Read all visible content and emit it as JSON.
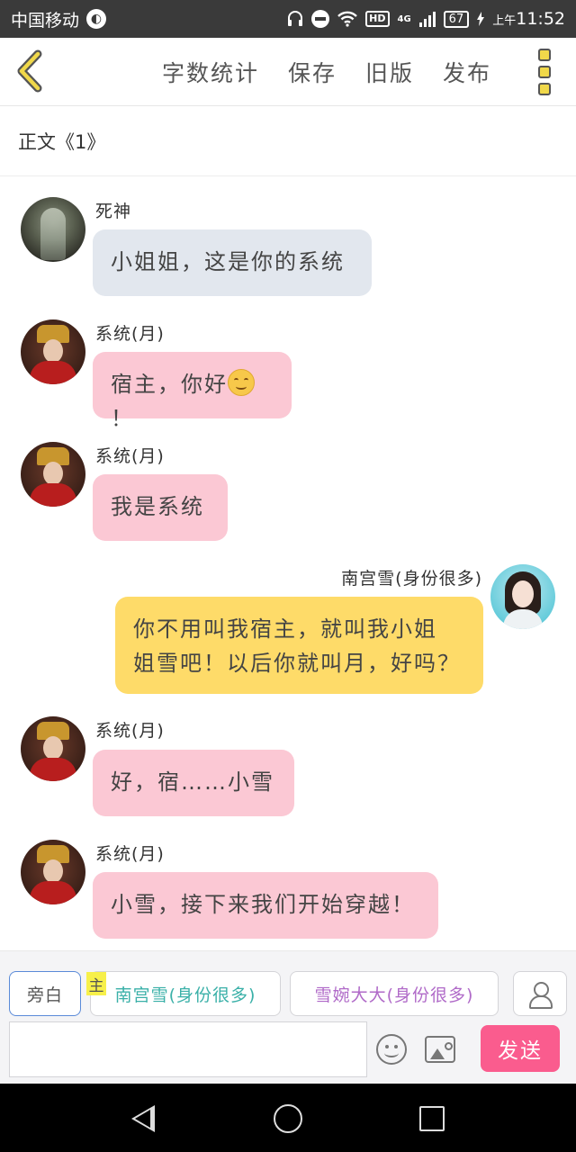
{
  "status_bar": {
    "carrier": "中国移动",
    "network": "4G",
    "hd": "HD",
    "battery": "67",
    "ampm": "上午",
    "time": "11:52"
  },
  "header": {
    "links": [
      "字数统计",
      "保存",
      "旧版",
      "发布"
    ]
  },
  "chapter_title": "正文《1》",
  "messages": [
    {
      "speaker": "死神",
      "text": "小姐姐，这是你的系统",
      "side": "left",
      "bubble": "gray",
      "avatar": "death"
    },
    {
      "speaker": "系统(月)",
      "text": "宿主，你好",
      "suffix": "！",
      "emoji": "smiling-face",
      "side": "left",
      "bubble": "pink",
      "avatar": "system"
    },
    {
      "speaker": "系统(月)",
      "text": "我是系统",
      "side": "left",
      "bubble": "pink",
      "avatar": "system"
    },
    {
      "speaker": "南宫雪(身份很多)",
      "text_lines": [
        "你不用叫我宿主，就叫我小姐",
        "姐雪吧！以后你就叫月，好吗？"
      ],
      "side": "right",
      "bubble": "yellow",
      "avatar": "nangong"
    },
    {
      "speaker": "系统(月)",
      "text": "好，宿……小雪",
      "side": "left",
      "bubble": "pink",
      "avatar": "system"
    },
    {
      "speaker": "系统(月)",
      "text": "小雪，接下来我们开始穿越！",
      "side": "left",
      "bubble": "pink",
      "avatar": "system"
    }
  ],
  "composer": {
    "roles": {
      "narrator": "旁白",
      "main_tag": "主",
      "role1": "南宫雪(身份很多)",
      "role2": "雪婉大大(身份很多)"
    },
    "input_value": "",
    "send_label": "发送"
  },
  "colors": {
    "bubble_gray": "#e2e7ee",
    "bubble_pink": "#fbc8d4",
    "bubble_yellow": "#fedb69",
    "send_button": "#fa5c8e",
    "accent_back": "#f0d84a"
  }
}
